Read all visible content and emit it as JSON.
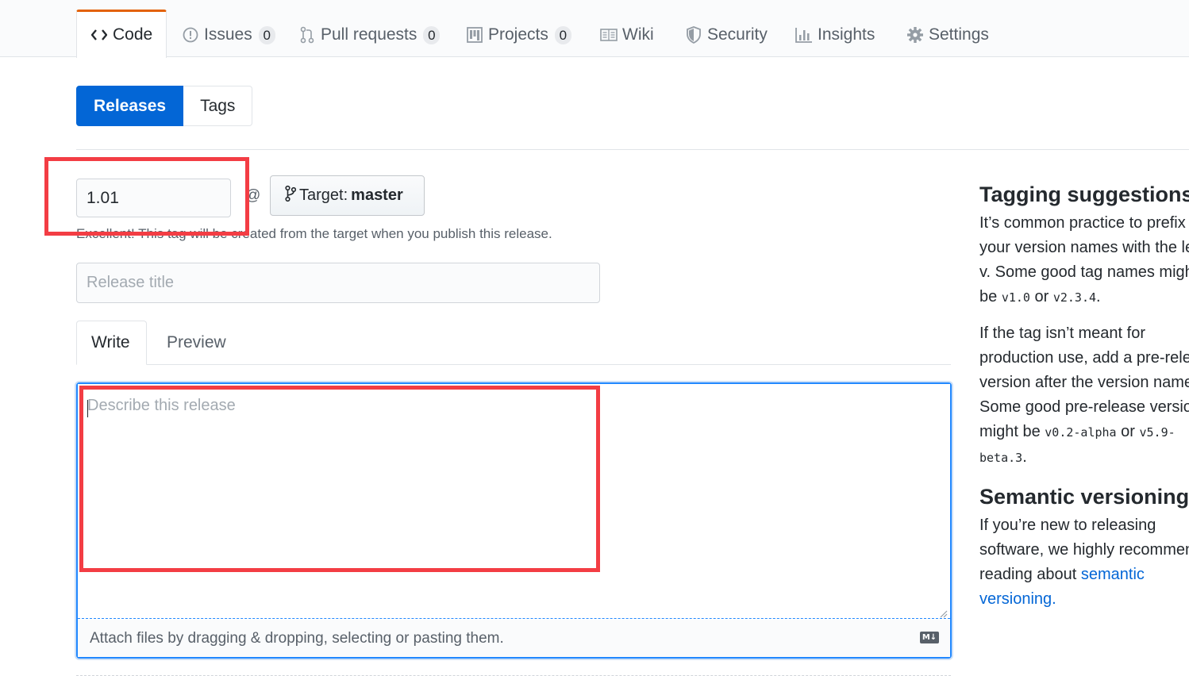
{
  "repo_nav": {
    "tabs": [
      {
        "label": "Code",
        "icon": "code-icon",
        "selected": true
      },
      {
        "label": "Issues",
        "icon": "issue-icon",
        "count": "0"
      },
      {
        "label": "Pull requests",
        "icon": "pull-request-icon",
        "count": "0"
      },
      {
        "label": "Projects",
        "icon": "project-icon",
        "count": "0"
      },
      {
        "label": "Wiki",
        "icon": "book-icon"
      },
      {
        "label": "Security",
        "icon": "shield-icon"
      },
      {
        "label": "Insights",
        "icon": "graph-icon"
      },
      {
        "label": "Settings",
        "icon": "gear-icon"
      }
    ]
  },
  "subnav": {
    "releases": "Releases",
    "tags": "Tags"
  },
  "form": {
    "tag_value": "1.01",
    "at_sign": "@",
    "target_prefix": "Target:",
    "target_branch": "master",
    "tag_note": "Excellent! This tag will be created from the target when you publish this release.",
    "title_placeholder": "Release title",
    "write_tab": "Write",
    "preview_tab": "Preview",
    "body_placeholder": "Describe this release",
    "attach_text": "Attach files by dragging & dropping, selecting or pasting them.",
    "markdown_badge": "M↓"
  },
  "sidebar": {
    "heading1": "Tagging suggestions",
    "p1_a": "It’s common practice to prefix your version names with the letter v. Some good tag names might be ",
    "p1_code1": "v1.0",
    "p1_mid": " or ",
    "p1_code2": "v2.3.4",
    "p1_end": ".",
    "p2_a": "If the tag isn’t meant for production use, add a pre-release version after the version name. Some good pre-release versions might be ",
    "p2_code1": "v0.2-alpha",
    "p2_mid": " or ",
    "p2_code2": "v5.9-beta.3",
    "p2_end": ".",
    "heading2": "Semantic versioning",
    "p3_a": "If you’re new to releasing software, we highly recommend reading about ",
    "p3_link": "semantic versioning.",
    "p3_end": ""
  },
  "colors": {
    "accent": "#0366d6",
    "highlight": "#f33d44",
    "selected_tab_border": "#e36209"
  }
}
